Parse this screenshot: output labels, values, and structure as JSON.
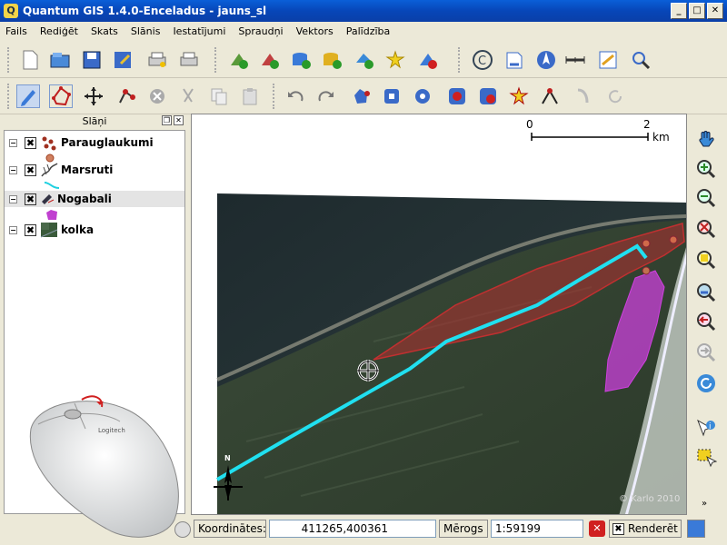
{
  "window": {
    "title": "Quantum GIS 1.4.0-Enceladus - jauns_sl",
    "app_icon": "Q"
  },
  "menu": [
    "Fails",
    "Rediģēt",
    "Skats",
    "Slānis",
    "Iestatījumi",
    "Spraudņi",
    "Vektors",
    "Palīdzība"
  ],
  "panel": {
    "title": "Slāņi"
  },
  "layers": [
    {
      "name": "Parauglaukumi",
      "checked": "✖"
    },
    {
      "name": "Marsruti",
      "checked": "✖"
    },
    {
      "name": "Nogabali",
      "checked": "✖"
    },
    {
      "name": "kolka",
      "checked": "✖"
    }
  ],
  "map": {
    "scalebar_start": "0",
    "scalebar_end": "2",
    "scalebar_unit": "km",
    "copyright": "© Karlo 2010",
    "north_label": "N"
  },
  "status": {
    "coord_label": "Koordinātes:",
    "coord_value": "411265,400361",
    "scale_label": "Mērogs",
    "scale_value": "1:59199",
    "render_label": "Renderēt"
  },
  "mouse": {
    "brand": "Logitech"
  },
  "colors": {
    "titlebar": "#0a5fd8",
    "polygon_red": "#b03030",
    "polygon_magenta": "#c040c0",
    "route_cyan": "#20e0f0"
  }
}
